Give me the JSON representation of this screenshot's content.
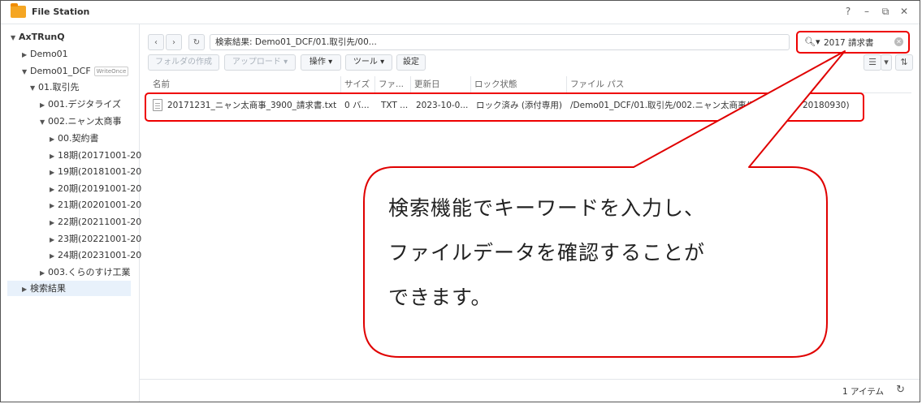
{
  "window": {
    "title": "File Station",
    "controls": [
      "?",
      "–",
      "⧉",
      "✕"
    ]
  },
  "sidebar": {
    "items": [
      {
        "label": "AxTRunQ",
        "arrow": "▼",
        "bold": true
      },
      {
        "label": "Demo01",
        "arrow": "▶"
      },
      {
        "label": "Demo01_DCF",
        "arrow": "▼",
        "badge": "WriteOnce"
      },
      {
        "label": "01.取引先",
        "arrow": "▼"
      },
      {
        "label": "001.デジタライズ",
        "arrow": "▶"
      },
      {
        "label": "002.ニャン太商事",
        "arrow": "▼"
      },
      {
        "label": "00.契約書",
        "arrow": "▶"
      },
      {
        "label": "18期(20171001-20",
        "arrow": "▶"
      },
      {
        "label": "19期(20181001-20",
        "arrow": "▶"
      },
      {
        "label": "20期(20191001-20",
        "arrow": "▶"
      },
      {
        "label": "21期(20201001-20",
        "arrow": "▶"
      },
      {
        "label": "22期(20211001-20",
        "arrow": "▶"
      },
      {
        "label": "23期(20221001-20",
        "arrow": "▶"
      },
      {
        "label": "24期(20231001-20",
        "arrow": "▶"
      },
      {
        "label": "003.くらのすけ工業",
        "arrow": "▶"
      },
      {
        "label": "検索結果",
        "arrow": "▶"
      }
    ]
  },
  "toolbar": {
    "back": "‹",
    "forward": "›",
    "refresh": "↻",
    "path": "検索結果: Demo01_DCF/01.取引先/00...",
    "search_value": "2017 請求書",
    "create_folder": "フォルダの作成",
    "upload": "アップロード ▾",
    "action": "操作 ▾",
    "tools": "ツール ▾",
    "settings": "設定",
    "view_list": "☰",
    "view_dropdown": "▾",
    "sort": "⇅"
  },
  "table": {
    "columns": [
      "名前",
      "サイズ",
      "ファ...",
      "更新日",
      "ロック状態",
      "ファイル パス"
    ],
    "rows": [
      {
        "name": "20171231_ニャン太商事_3900_請求書.txt",
        "size": "0 バ...",
        "type": "TXT ...",
        "modified": "2023-10-0...",
        "lock": "ロック済み (添付専用)",
        "path": "/Demo01_DCF/01.取引先/002.ニャン太商事/18期",
        "path_tail": "20180930)"
      }
    ]
  },
  "footer": {
    "count": "1 アイテム",
    "refresh": "↻"
  },
  "callout": {
    "lines": [
      "検索機能でキーワードを入力し、",
      "ファイルデータを確認することが",
      "できます。"
    ]
  },
  "colors": {
    "accent_red": "#e00000",
    "folder": "#f5a623",
    "selected_bg": "#e8f1fb"
  }
}
